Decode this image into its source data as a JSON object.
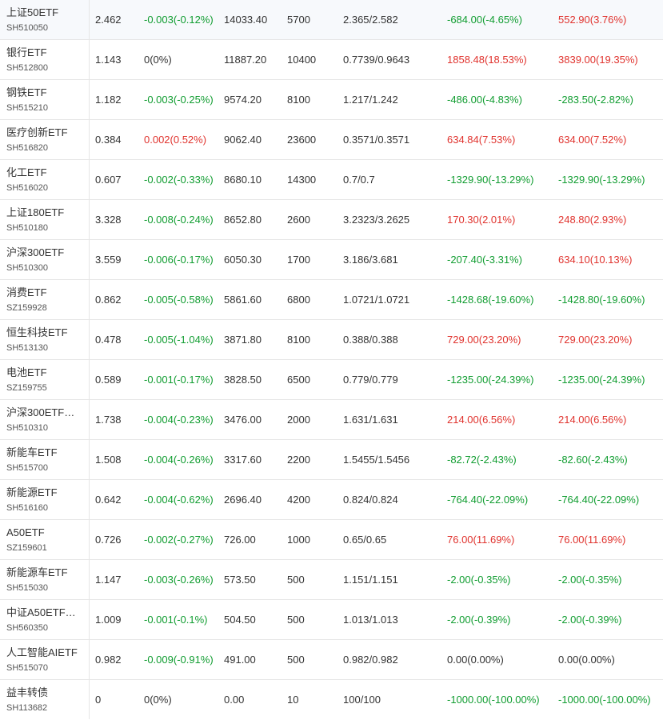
{
  "colors": {
    "up": "#e0332e",
    "down": "#119d31",
    "flat": "#333333"
  },
  "rows": [
    {
      "name": "上证50ETF",
      "code": "SH510050",
      "price": "2.462",
      "change": "-0.003(-0.12%)",
      "change_dir": "down",
      "value": "14033.40",
      "qty": "5700",
      "cost": "2.365/2.582",
      "pnl1": "-684.00(-4.65%)",
      "pnl1_dir": "down",
      "pnl2": "552.90(3.76%)",
      "pnl2_dir": "up"
    },
    {
      "name": "银行ETF",
      "code": "SH512800",
      "price": "1.143",
      "change": "0(0%)",
      "change_dir": "flat",
      "value": "11887.20",
      "qty": "10400",
      "cost": "0.7739/0.9643",
      "pnl1": "1858.48(18.53%)",
      "pnl1_dir": "up",
      "pnl2": "3839.00(19.35%)",
      "pnl2_dir": "up"
    },
    {
      "name": "钢铁ETF",
      "code": "SH515210",
      "price": "1.182",
      "change": "-0.003(-0.25%)",
      "change_dir": "down",
      "value": "9574.20",
      "qty": "8100",
      "cost": "1.217/1.242",
      "pnl1": "-486.00(-4.83%)",
      "pnl1_dir": "down",
      "pnl2": "-283.50(-2.82%)",
      "pnl2_dir": "down"
    },
    {
      "name": "医疗创新ETF",
      "code": "SH516820",
      "price": "0.384",
      "change": "0.002(0.52%)",
      "change_dir": "up",
      "value": "9062.40",
      "qty": "23600",
      "cost": "0.3571/0.3571",
      "pnl1": "634.84(7.53%)",
      "pnl1_dir": "up",
      "pnl2": "634.00(7.52%)",
      "pnl2_dir": "up"
    },
    {
      "name": "化工ETF",
      "code": "SH516020",
      "price": "0.607",
      "change": "-0.002(-0.33%)",
      "change_dir": "down",
      "value": "8680.10",
      "qty": "14300",
      "cost": "0.7/0.7",
      "pnl1": "-1329.90(-13.29%)",
      "pnl1_dir": "down",
      "pnl2": "-1329.90(-13.29%)",
      "pnl2_dir": "down"
    },
    {
      "name": "上证180ETF",
      "code": "SH510180",
      "price": "3.328",
      "change": "-0.008(-0.24%)",
      "change_dir": "down",
      "value": "8652.80",
      "qty": "2600",
      "cost": "3.2323/3.2625",
      "pnl1": "170.30(2.01%)",
      "pnl1_dir": "up",
      "pnl2": "248.80(2.93%)",
      "pnl2_dir": "up"
    },
    {
      "name": "沪深300ETF",
      "code": "SH510300",
      "price": "3.559",
      "change": "-0.006(-0.17%)",
      "change_dir": "down",
      "value": "6050.30",
      "qty": "1700",
      "cost": "3.186/3.681",
      "pnl1": "-207.40(-3.31%)",
      "pnl1_dir": "down",
      "pnl2": "634.10(10.13%)",
      "pnl2_dir": "up"
    },
    {
      "name": "消费ETF",
      "code": "SZ159928",
      "price": "0.862",
      "change": "-0.005(-0.58%)",
      "change_dir": "down",
      "value": "5861.60",
      "qty": "6800",
      "cost": "1.0721/1.0721",
      "pnl1": "-1428.68(-19.60%)",
      "pnl1_dir": "down",
      "pnl2": "-1428.80(-19.60%)",
      "pnl2_dir": "down"
    },
    {
      "name": "恒生科技ETF",
      "code": "SH513130",
      "price": "0.478",
      "change": "-0.005(-1.04%)",
      "change_dir": "down",
      "value": "3871.80",
      "qty": "8100",
      "cost": "0.388/0.388",
      "pnl1": "729.00(23.20%)",
      "pnl1_dir": "up",
      "pnl2": "729.00(23.20%)",
      "pnl2_dir": "up"
    },
    {
      "name": "电池ETF",
      "code": "SZ159755",
      "price": "0.589",
      "change": "-0.001(-0.17%)",
      "change_dir": "down",
      "value": "3828.50",
      "qty": "6500",
      "cost": "0.779/0.779",
      "pnl1": "-1235.00(-24.39%)",
      "pnl1_dir": "down",
      "pnl2": "-1235.00(-24.39%)",
      "pnl2_dir": "down"
    },
    {
      "name": "沪深300ETF…",
      "code": "SH510310",
      "price": "1.738",
      "change": "-0.004(-0.23%)",
      "change_dir": "down",
      "value": "3476.00",
      "qty": "2000",
      "cost": "1.631/1.631",
      "pnl1": "214.00(6.56%)",
      "pnl1_dir": "up",
      "pnl2": "214.00(6.56%)",
      "pnl2_dir": "up"
    },
    {
      "name": "新能车ETF",
      "code": "SH515700",
      "price": "1.508",
      "change": "-0.004(-0.26%)",
      "change_dir": "down",
      "value": "3317.60",
      "qty": "2200",
      "cost": "1.5455/1.5456",
      "pnl1": "-82.72(-2.43%)",
      "pnl1_dir": "down",
      "pnl2": "-82.60(-2.43%)",
      "pnl2_dir": "down"
    },
    {
      "name": "新能源ETF",
      "code": "SH516160",
      "price": "0.642",
      "change": "-0.004(-0.62%)",
      "change_dir": "down",
      "value": "2696.40",
      "qty": "4200",
      "cost": "0.824/0.824",
      "pnl1": "-764.40(-22.09%)",
      "pnl1_dir": "down",
      "pnl2": "-764.40(-22.09%)",
      "pnl2_dir": "down"
    },
    {
      "name": "A50ETF",
      "code": "SZ159601",
      "price": "0.726",
      "change": "-0.002(-0.27%)",
      "change_dir": "down",
      "value": "726.00",
      "qty": "1000",
      "cost": "0.65/0.65",
      "pnl1": "76.00(11.69%)",
      "pnl1_dir": "up",
      "pnl2": "76.00(11.69%)",
      "pnl2_dir": "up"
    },
    {
      "name": "新能源车ETF",
      "code": "SH515030",
      "price": "1.147",
      "change": "-0.003(-0.26%)",
      "change_dir": "down",
      "value": "573.50",
      "qty": "500",
      "cost": "1.151/1.151",
      "pnl1": "-2.00(-0.35%)",
      "pnl1_dir": "down",
      "pnl2": "-2.00(-0.35%)",
      "pnl2_dir": "down"
    },
    {
      "name": "中证A50ETF…",
      "code": "SH560350",
      "price": "1.009",
      "change": "-0.001(-0.1%)",
      "change_dir": "down",
      "value": "504.50",
      "qty": "500",
      "cost": "1.013/1.013",
      "pnl1": "-2.00(-0.39%)",
      "pnl1_dir": "down",
      "pnl2": "-2.00(-0.39%)",
      "pnl2_dir": "down"
    },
    {
      "name": "人工智能AIETF",
      "code": "SH515070",
      "price": "0.982",
      "change": "-0.009(-0.91%)",
      "change_dir": "down",
      "value": "491.00",
      "qty": "500",
      "cost": "0.982/0.982",
      "pnl1": "0.00(0.00%)",
      "pnl1_dir": "flat",
      "pnl2": "0.00(0.00%)",
      "pnl2_dir": "flat"
    },
    {
      "name": "益丰转债",
      "code": "SH113682",
      "price": "0",
      "change": "0(0%)",
      "change_dir": "flat",
      "value": "0.00",
      "qty": "10",
      "cost": "100/100",
      "pnl1": "-1000.00(-100.00%)",
      "pnl1_dir": "down",
      "pnl2": "-1000.00(-100.00%)",
      "pnl2_dir": "down"
    }
  ]
}
